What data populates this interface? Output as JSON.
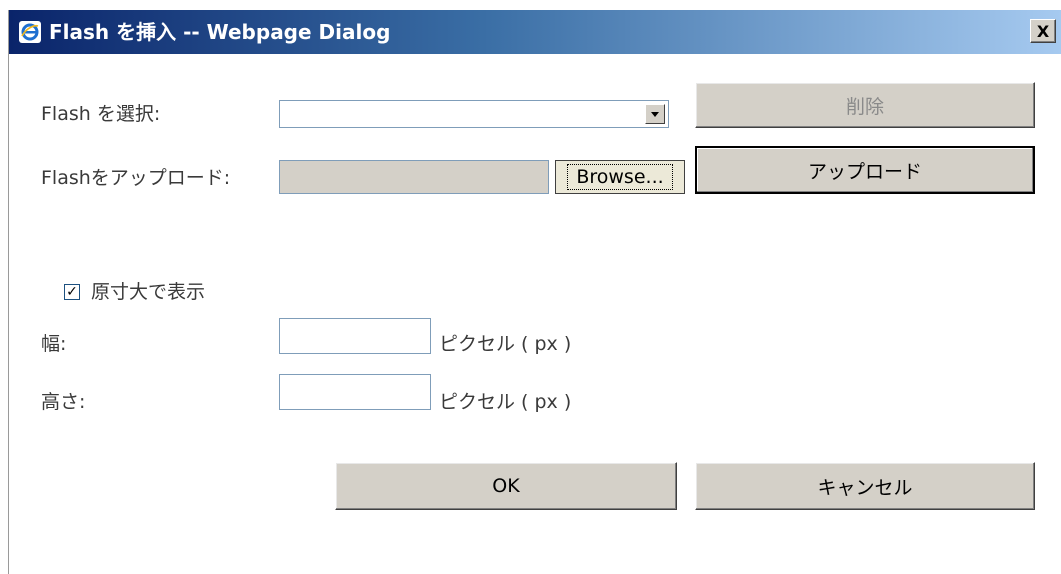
{
  "window": {
    "title": "Flash を挿入 -- Webpage Dialog",
    "close_label": "X"
  },
  "form": {
    "select_flash_label": "Flash を選択:",
    "select_flash_value": "",
    "delete_button": "削除",
    "upload_flash_label": "Flashをアップロード:",
    "upload_path_value": "",
    "browse_button": "Browse...",
    "upload_button": "アップロード",
    "original_size_label": "原寸大で表示",
    "original_size_checked": true,
    "width_label": "幅:",
    "width_value": "",
    "width_unit": "ピクセル ( px )",
    "height_label": "高さ:",
    "height_value": "",
    "height_unit": "ピクセル ( px )"
  },
  "actions": {
    "ok_button": "OK",
    "cancel_button": "キャンセル"
  }
}
